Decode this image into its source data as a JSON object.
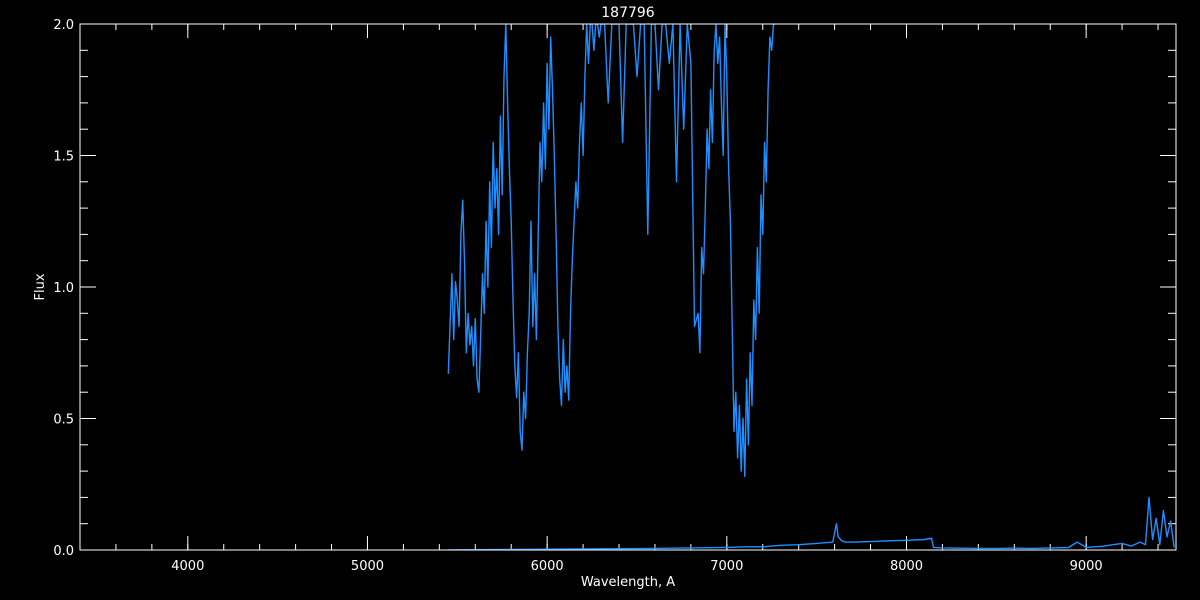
{
  "chart_data": {
    "type": "line",
    "title": "187796",
    "xlabel": "Wavelength, A",
    "ylabel": "Flux",
    "xlim": [
      3400,
      9500
    ],
    "ylim": [
      0,
      2
    ],
    "x_ticks": [
      4000,
      5000,
      6000,
      7000,
      8000,
      9000
    ],
    "x_tick_labels": [
      "4000",
      "5000",
      "6000",
      "7000",
      "8000",
      "9000"
    ],
    "y_ticks": [
      0,
      0.5,
      1,
      1.5,
      2
    ],
    "y_tick_labels": [
      "0.0",
      "0.5",
      "1.0",
      "1.5",
      "2.0"
    ],
    "x_minor_step": 200,
    "y_minor_step": 0.1,
    "grid": false,
    "colors": {
      "background": "#000000",
      "axes": "#ffffff",
      "text": "#ffffff",
      "series": "#1f8fff"
    },
    "series": [
      {
        "values_x": [
          5450,
          5470,
          5480,
          5490,
          5500,
          5510,
          5520,
          5530,
          5540,
          5550,
          5560,
          5570,
          5580,
          5590,
          5600,
          5610,
          5620,
          5630,
          5640,
          5650,
          5660,
          5670,
          5680,
          5690,
          5700,
          5710,
          5720,
          5730,
          5740,
          5750,
          5760,
          5770,
          5780,
          5790,
          5800,
          5810,
          5820,
          5830,
          5840,
          5850,
          5860,
          5870,
          5880,
          5890,
          5900,
          5910,
          5920,
          5930,
          5940,
          5950,
          5960,
          5970,
          5980,
          5990,
          6000,
          6010,
          6020,
          6030,
          6040,
          6050,
          6060,
          6070,
          6080,
          6090,
          6100,
          6110,
          6120,
          6130,
          6140,
          6150,
          6160,
          6170,
          6180,
          6190,
          6200,
          6210,
          6220,
          6230,
          6240,
          6250,
          6260,
          6270,
          6280,
          6290,
          6300,
          6310,
          6320,
          6340,
          6360,
          6380,
          6400,
          6420,
          6440,
          6460,
          6480,
          6500,
          6520,
          6540,
          6560,
          6580,
          6600,
          6620,
          6640,
          6660,
          6680,
          6700,
          6720,
          6740,
          6760,
          6780,
          6800,
          6820,
          6840,
          6850,
          6860,
          6870,
          6880,
          6890,
          6900,
          6910,
          6920,
          6930,
          6940,
          6950,
          6960,
          6970,
          6980,
          6990,
          7000,
          7010,
          7020,
          7030,
          7040,
          7050,
          7060,
          7070,
          7080,
          7090,
          7100,
          7110,
          7120,
          7130,
          7140,
          7150,
          7160,
          7170,
          7180,
          7190,
          7200,
          7210,
          7220,
          7230,
          7240,
          7250,
          7260,
          7270,
          7280
        ],
        "values_y": [
          0.67,
          1.05,
          0.8,
          1.02,
          0.95,
          0.85,
          1.2,
          1.33,
          1.1,
          0.75,
          0.9,
          0.78,
          0.85,
          0.7,
          0.88,
          0.65,
          0.6,
          0.82,
          1.05,
          0.9,
          1.25,
          1.0,
          1.4,
          1.15,
          1.55,
          1.3,
          1.45,
          1.2,
          1.65,
          1.35,
          1.8,
          2.0,
          1.7,
          1.45,
          1.25,
          0.95,
          0.7,
          0.58,
          0.75,
          0.45,
          0.38,
          0.6,
          0.5,
          0.75,
          0.9,
          1.25,
          0.85,
          1.05,
          0.8,
          1.2,
          1.55,
          1.4,
          1.7,
          1.45,
          1.85,
          1.6,
          1.95,
          1.75,
          1.5,
          1.2,
          0.85,
          0.65,
          0.55,
          0.8,
          0.6,
          0.7,
          0.57,
          0.9,
          1.1,
          1.25,
          1.4,
          1.3,
          1.55,
          1.7,
          1.5,
          1.8,
          2.0,
          1.85,
          2.0,
          2.0,
          1.9,
          2.0,
          2.0,
          1.95,
          2.0,
          2.0,
          2.0,
          1.7,
          2.0,
          2.0,
          2.0,
          1.55,
          2.0,
          2.0,
          2.0,
          1.8,
          2.0,
          2.0,
          1.2,
          2.0,
          2.0,
          1.75,
          2.0,
          2.0,
          1.85,
          2.0,
          1.4,
          2.0,
          1.6,
          2.0,
          1.85,
          0.85,
          0.9,
          0.75,
          1.15,
          1.05,
          1.3,
          1.6,
          1.45,
          1.75,
          1.55,
          1.9,
          2.0,
          1.85,
          1.95,
          1.7,
          1.5,
          2.0,
          1.8,
          1.45,
          1.25,
          0.85,
          0.45,
          0.6,
          0.35,
          0.55,
          0.3,
          0.5,
          0.28,
          0.65,
          0.4,
          0.75,
          0.55,
          0.95,
          0.8,
          1.15,
          0.9,
          1.35,
          1.2,
          1.55,
          1.4,
          1.75,
          1.95,
          1.9,
          2.0,
          2.0
        ]
      },
      {
        "values_x": [
          5450,
          5600,
          5800,
          6000,
          6200,
          6400,
          6600,
          6800,
          7000,
          7100,
          7200,
          7300,
          7400,
          7500,
          7590,
          7610,
          7620,
          7640,
          7660,
          7700,
          7800,
          7900,
          8000,
          8100,
          8140,
          8150,
          8200,
          8300,
          8400,
          8500,
          8600,
          8700,
          8800,
          8900,
          8950,
          9000,
          9050,
          9100,
          9150,
          9200,
          9250,
          9300,
          9330,
          9350,
          9370,
          9390,
          9410,
          9430,
          9450,
          9470,
          9490
        ],
        "values_y": [
          0.0,
          0.001,
          0.002,
          0.003,
          0.004,
          0.005,
          0.006,
          0.008,
          0.01,
          0.012,
          0.012,
          0.018,
          0.02,
          0.025,
          0.03,
          0.1,
          0.05,
          0.035,
          0.03,
          0.03,
          0.032,
          0.035,
          0.037,
          0.04,
          0.045,
          0.01,
          0.008,
          0.007,
          0.006,
          0.006,
          0.007,
          0.006,
          0.008,
          0.009,
          0.03,
          0.01,
          0.012,
          0.015,
          0.02,
          0.025,
          0.015,
          0.03,
          0.02,
          0.2,
          0.04,
          0.12,
          0.02,
          0.15,
          0.05,
          0.11,
          0.01
        ]
      }
    ]
  }
}
